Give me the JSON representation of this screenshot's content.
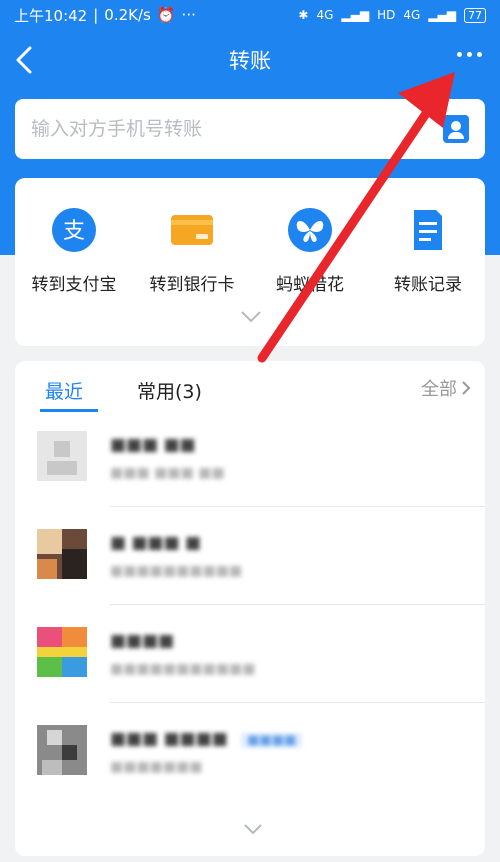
{
  "status_bar": {
    "time": "上午10:42",
    "speed": "0.2K/s",
    "alarm_icon": "alarm-icon",
    "dots": "···",
    "network1": "4G",
    "hd": "HD",
    "network2": "4G",
    "battery": "77"
  },
  "nav": {
    "title": "转账",
    "back_icon": "back-chevron-icon",
    "more_icon": "more-dots-icon"
  },
  "search": {
    "placeholder": "输入对方手机号转账",
    "contact_icon": "contact-book-icon"
  },
  "actions": [
    {
      "label": "转到支付宝",
      "icon": "alipay-icon",
      "color": "#1e84f0"
    },
    {
      "label": "转到银行卡",
      "icon": "bank-card-icon",
      "color": "#f5a623"
    },
    {
      "label": "蚂蚁借花",
      "icon": "butterfly-icon",
      "color": "#1e84f0"
    },
    {
      "label": "转账记录",
      "icon": "record-icon",
      "color": "#1e84f0"
    }
  ],
  "list": {
    "tabs": [
      {
        "label": "最近",
        "active": true
      },
      {
        "label": "常用(3)",
        "active": false
      }
    ],
    "all_label": "全部",
    "rows": [
      {
        "name": "■■■ ■■",
        "sub": "■■■ ■■■ ■■"
      },
      {
        "name": "■ ■■■ ■",
        "sub": "■■■■■■■■■■"
      },
      {
        "name": "■■■■",
        "sub": "■■■■■■■■■■■"
      },
      {
        "name": "■■■ ■■■■",
        "tag": "■■■■",
        "sub": "■■■■■■■"
      }
    ]
  },
  "colors": {
    "primary": "#1e84f0",
    "annotation_arrow": "#e8262b"
  }
}
